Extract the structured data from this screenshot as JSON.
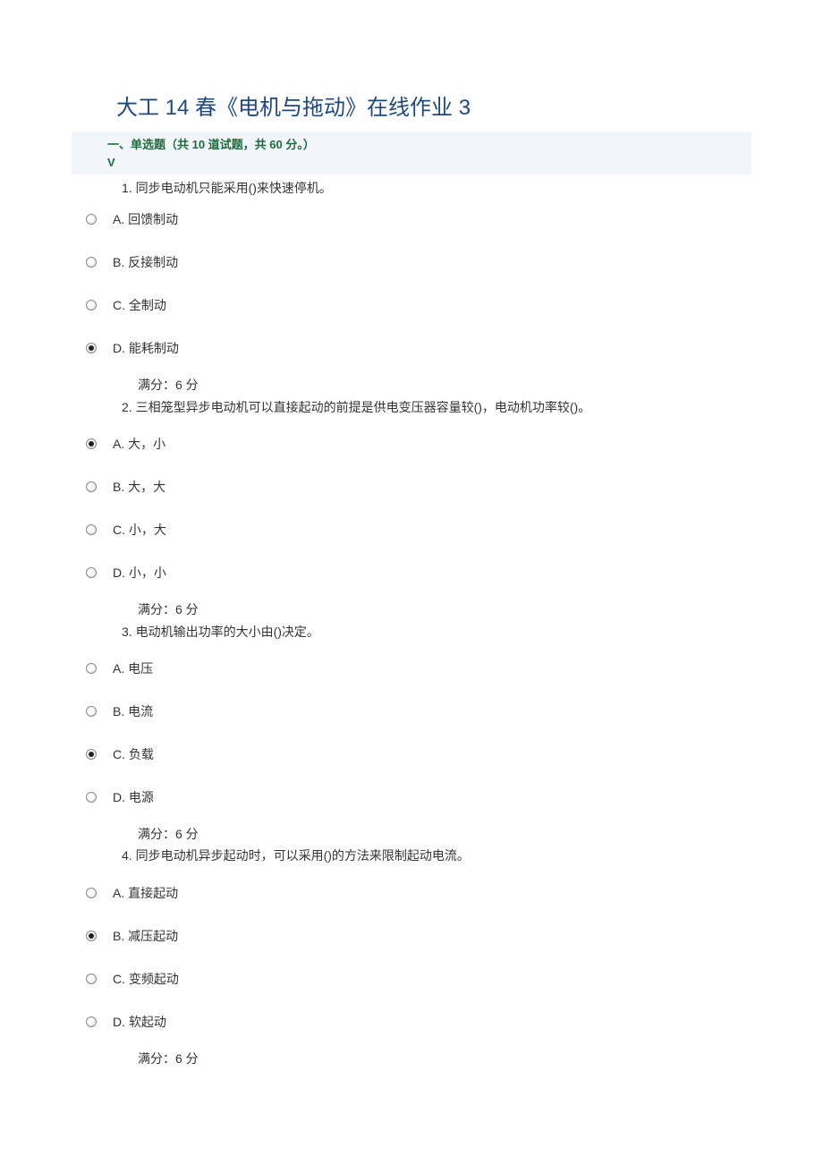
{
  "page_title": "大工 14 春《电机与拖动》在线作业 3",
  "section": {
    "title": "一、单选题（共 10 道试题，共 60 分。）",
    "sub": "V"
  },
  "questions": [
    {
      "number": "1.",
      "text": "同步电动机只能采用()来快速停机。",
      "options": [
        {
          "label": "A. 回馈制动",
          "selected": false
        },
        {
          "label": "B. 反接制动",
          "selected": false
        },
        {
          "label": "C. 全制动",
          "selected": false
        },
        {
          "label": "D. 能耗制动",
          "selected": true
        }
      ],
      "score": "满分：6 分"
    },
    {
      "number": "2.",
      "text": "三相笼型异步电动机可以直接起动的前提是供电变压器容量较()，电动机功率较()。",
      "options": [
        {
          "label": "A. 大，小",
          "selected": true
        },
        {
          "label": "B. 大，大",
          "selected": false
        },
        {
          "label": "C. 小，大",
          "selected": false
        },
        {
          "label": "D. 小，小",
          "selected": false
        }
      ],
      "score": "满分：6 分"
    },
    {
      "number": "3.",
      "text": "电动机输出功率的大小由()决定。",
      "options": [
        {
          "label": "A. 电压",
          "selected": false
        },
        {
          "label": "B. 电流",
          "selected": false
        },
        {
          "label": "C. 负载",
          "selected": true
        },
        {
          "label": "D. 电源",
          "selected": false
        }
      ],
      "score": "满分：6 分"
    },
    {
      "number": "4.",
      "text": "同步电动机异步起动时，可以采用()的方法来限制起动电流。",
      "options": [
        {
          "label": "A. 直接起动",
          "selected": false
        },
        {
          "label": "B. 减压起动",
          "selected": true
        },
        {
          "label": "C. 变频起动",
          "selected": false
        },
        {
          "label": "D. 软起动",
          "selected": false
        }
      ],
      "score": "满分：6 分"
    }
  ]
}
